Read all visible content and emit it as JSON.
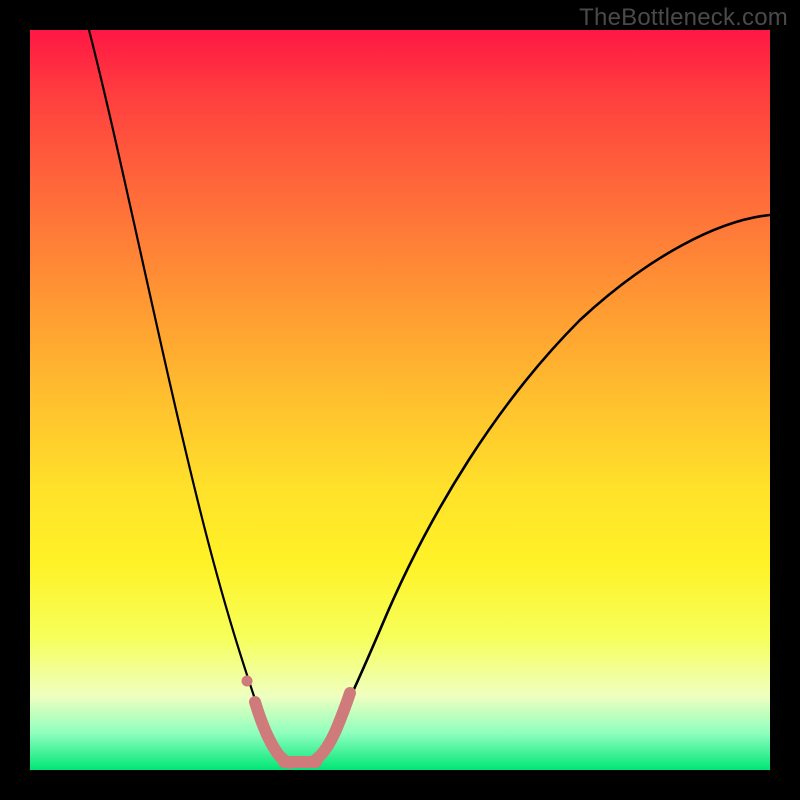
{
  "watermark": "TheBottleneck.com",
  "chart_data": {
    "type": "line",
    "title": "",
    "xlabel": "",
    "ylabel": "",
    "xlim": [
      0,
      100
    ],
    "ylim": [
      0,
      100
    ],
    "background": {
      "description": "vertical red-to-green gradient indicating severity (red high, green low)",
      "stops": [
        {
          "pos": 0.0,
          "color": "#ff1744"
        },
        {
          "pos": 0.5,
          "color": "#ffc02e"
        },
        {
          "pos": 0.72,
          "color": "#fff227"
        },
        {
          "pos": 0.95,
          "color": "#8fffbe"
        },
        {
          "pos": 1.0,
          "color": "#00e676"
        }
      ]
    },
    "series": [
      {
        "name": "bottleneck-curve-left",
        "stroke": "#000000",
        "x": [
          8,
          10,
          12,
          14,
          16,
          18,
          20,
          22,
          24,
          26,
          28,
          30,
          32
        ],
        "y": [
          100,
          88,
          76,
          65,
          55,
          46,
          37,
          29,
          22,
          16,
          11,
          7,
          4
        ]
      },
      {
        "name": "bottleneck-curve-right",
        "stroke": "#000000",
        "x": [
          38,
          42,
          46,
          50,
          55,
          60,
          65,
          70,
          75,
          80,
          85,
          90,
          95,
          100
        ],
        "y": [
          4,
          8,
          14,
          21,
          29,
          37,
          44,
          51,
          57,
          62,
          66,
          69,
          72,
          74
        ]
      },
      {
        "name": "highlight-band",
        "stroke": "#d98080",
        "x": [
          29,
          30,
          32,
          34,
          36,
          38,
          40
        ],
        "y": [
          10,
          6,
          3,
          2,
          2,
          3,
          7
        ]
      },
      {
        "name": "highlight-dot",
        "type": "scatter",
        "stroke": "#d98080",
        "x": [
          28.5
        ],
        "y": [
          13
        ]
      }
    ],
    "notch": {
      "x_range": [
        32,
        38
      ],
      "y": 2
    }
  }
}
